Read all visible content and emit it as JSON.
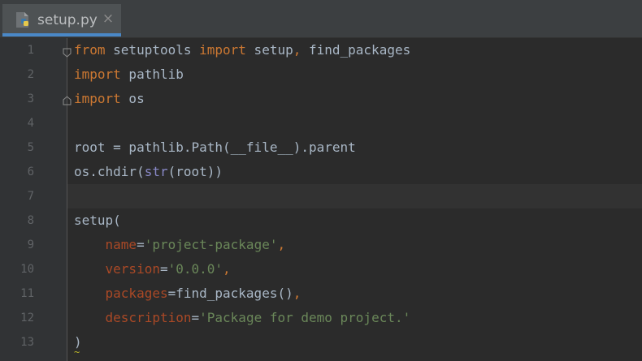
{
  "tab": {
    "filename": "setup.py",
    "close_glyph": "×",
    "icon": "python-file-icon",
    "active_indicator_color": "#4a88c7"
  },
  "colors": {
    "background": "#2b2b2b",
    "gutter": "#313335",
    "keyword": "#cc7832",
    "identifier": "#a9b7c6",
    "builtin": "#8888c6",
    "parameter": "#aa4926",
    "string": "#6a8759"
  },
  "editor": {
    "current_line": 7,
    "line_numbers": [
      "1",
      "2",
      "3",
      "4",
      "5",
      "6",
      "7",
      "8",
      "9",
      "10",
      "11",
      "12",
      "13"
    ],
    "lines": [
      {
        "tokens": [
          {
            "t": "from",
            "c": "kw"
          },
          {
            "t": " setuptools ",
            "c": "id"
          },
          {
            "t": "import",
            "c": "kw"
          },
          {
            "t": " setup",
            "c": "id"
          },
          {
            "t": ",",
            "c": "kw"
          },
          {
            "t": " find_packages",
            "c": "id"
          }
        ]
      },
      {
        "tokens": [
          {
            "t": "import",
            "c": "kw"
          },
          {
            "t": " pathlib",
            "c": "id"
          }
        ]
      },
      {
        "tokens": [
          {
            "t": "import",
            "c": "kw"
          },
          {
            "t": " os",
            "c": "id"
          }
        ]
      },
      {
        "tokens": []
      },
      {
        "tokens": [
          {
            "t": "root = pathlib.Path(__file__).parent",
            "c": "id"
          }
        ]
      },
      {
        "tokens": [
          {
            "t": "os.chdir(",
            "c": "id"
          },
          {
            "t": "str",
            "c": "builtin"
          },
          {
            "t": "(root))",
            "c": "id"
          }
        ]
      },
      {
        "tokens": []
      },
      {
        "tokens": [
          {
            "t": "setup(",
            "c": "id"
          }
        ]
      },
      {
        "tokens": [
          {
            "t": "    ",
            "c": "id"
          },
          {
            "t": "name",
            "c": "param"
          },
          {
            "t": "=",
            "c": "id"
          },
          {
            "t": "'project-package'",
            "c": "str"
          },
          {
            "t": ",",
            "c": "kw"
          }
        ]
      },
      {
        "tokens": [
          {
            "t": "    ",
            "c": "id"
          },
          {
            "t": "version",
            "c": "param"
          },
          {
            "t": "=",
            "c": "id"
          },
          {
            "t": "'0.0.0'",
            "c": "str"
          },
          {
            "t": ",",
            "c": "kw"
          }
        ]
      },
      {
        "tokens": [
          {
            "t": "    ",
            "c": "id"
          },
          {
            "t": "packages",
            "c": "param"
          },
          {
            "t": "=find_packages()",
            "c": "id"
          },
          {
            "t": ",",
            "c": "kw"
          }
        ]
      },
      {
        "tokens": [
          {
            "t": "    ",
            "c": "id"
          },
          {
            "t": "description",
            "c": "param"
          },
          {
            "t": "=",
            "c": "id"
          },
          {
            "t": "'Package for demo project.'",
            "c": "str"
          }
        ]
      },
      {
        "tokens": [
          {
            "t": ")",
            "c": "id"
          }
        ]
      }
    ],
    "fold_markers": [
      1,
      3
    ],
    "eof_marker": "~"
  }
}
